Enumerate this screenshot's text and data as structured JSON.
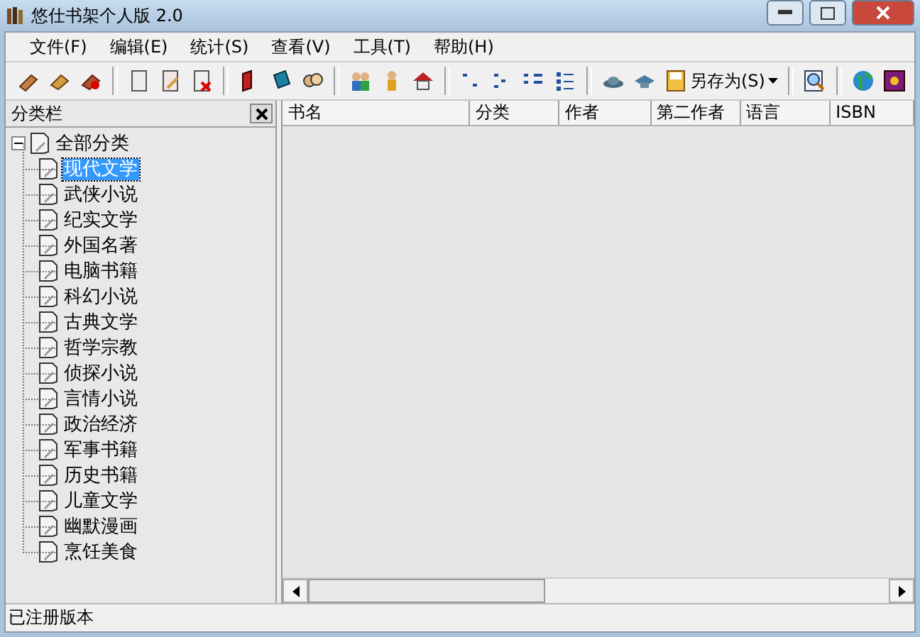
{
  "window": {
    "title": "悠仕书架个人版 2.0"
  },
  "menu": [
    "文件(F)",
    "编辑(E)",
    "统计(S)",
    "查看(V)",
    "工具(T)",
    "帮助(H)"
  ],
  "toolbar": {
    "save_as": "另存为(S)"
  },
  "sidebar": {
    "title": "分类栏",
    "tree": {
      "label": "全部分类",
      "expanded": true,
      "selected": false,
      "children": [
        {
          "label": "现代文学",
          "selected": true
        },
        {
          "label": "武侠小说",
          "selected": false
        },
        {
          "label": "纪实文学",
          "selected": false
        },
        {
          "label": "外国名著",
          "selected": false
        },
        {
          "label": "电脑书籍",
          "selected": false
        },
        {
          "label": "科幻小说",
          "selected": false
        },
        {
          "label": "古典文学",
          "selected": false
        },
        {
          "label": "哲学宗教",
          "selected": false
        },
        {
          "label": "侦探小说",
          "selected": false
        },
        {
          "label": "言情小说",
          "selected": false
        },
        {
          "label": "政治经济",
          "selected": false
        },
        {
          "label": "军事书籍",
          "selected": false
        },
        {
          "label": "历史书籍",
          "selected": false
        },
        {
          "label": "儿童文学",
          "selected": false
        },
        {
          "label": "幽默漫画",
          "selected": false
        },
        {
          "label": "烹饪美食",
          "selected": false
        }
      ]
    }
  },
  "table": {
    "columns": [
      "书名",
      "分类",
      "作者",
      "第二作者",
      "语言",
      "ISBN"
    ]
  },
  "status_bar": "已注册版本"
}
